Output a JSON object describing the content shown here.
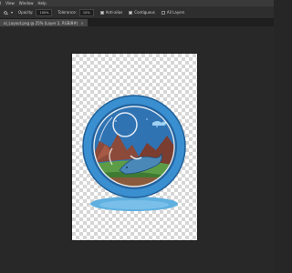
{
  "menu": {
    "items": [
      "ID",
      "View",
      "Window",
      "Help"
    ]
  },
  "options_bar": {
    "opacity_label": "Opacity:",
    "opacity_value": "100%",
    "tolerance_label": "Tolerance:",
    "tolerance_value": "10%",
    "anti_alias_label": "Anti-alias",
    "anti_alias_checked": true,
    "contiguous_label": "Contiguous",
    "contiguous_checked": true,
    "all_layers_label": "All Layers",
    "all_layers_checked": false
  },
  "document_tab": {
    "title": "ol_Layout.png @ 25% (Layer 2, RGB/8#)",
    "close": "×"
  },
  "artwork": {
    "name": "whale-in-bubble-illustration",
    "colors": {
      "ring": "#3a8fd0",
      "ring_dark": "#23639f",
      "sky": "#2f73b3",
      "rocks": "#8b4a3a",
      "grass": "#5d9c47",
      "whale": "#4a88b8",
      "puddle": "#5fb0e0"
    }
  }
}
